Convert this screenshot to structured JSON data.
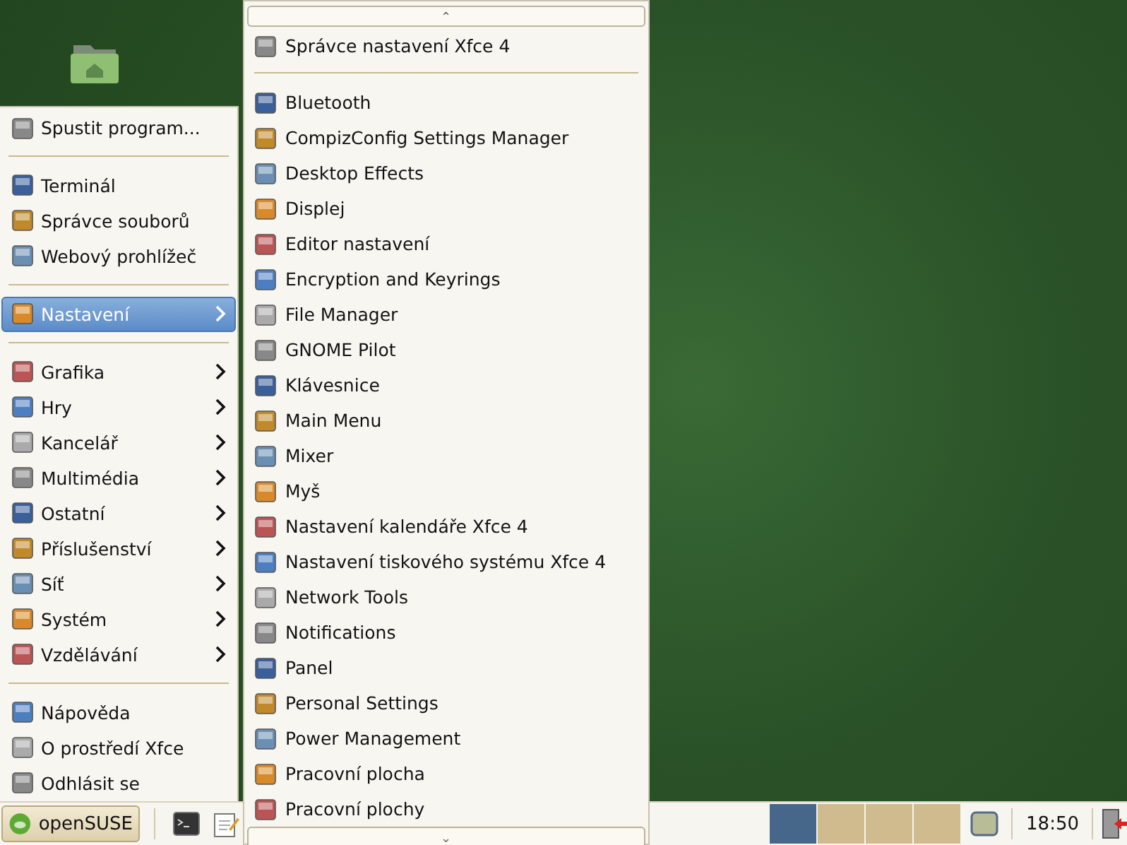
{
  "menu": {
    "sections": [
      {
        "items": [
          {
            "label": "Spustit program...",
            "kind": "item",
            "selected": false
          }
        ]
      },
      {
        "items": [
          {
            "label": "Terminál",
            "kind": "item",
            "selected": false
          },
          {
            "label": "Správce souborů",
            "kind": "item",
            "selected": false
          },
          {
            "label": "Webový prohlížeč",
            "kind": "item",
            "selected": false
          }
        ]
      },
      {
        "items": [
          {
            "label": "Nastavení",
            "kind": "submenu",
            "selected": true
          }
        ]
      },
      {
        "items": [
          {
            "label": "Grafika",
            "kind": "submenu",
            "selected": false
          },
          {
            "label": "Hry",
            "kind": "submenu",
            "selected": false
          },
          {
            "label": "Kancelář",
            "kind": "submenu",
            "selected": false
          },
          {
            "label": "Multimédia",
            "kind": "submenu",
            "selected": false
          },
          {
            "label": "Ostatní",
            "kind": "submenu",
            "selected": false
          },
          {
            "label": "Příslušenství",
            "kind": "submenu",
            "selected": false
          },
          {
            "label": "Síť",
            "kind": "submenu",
            "selected": false
          },
          {
            "label": "Systém",
            "kind": "submenu",
            "selected": false
          },
          {
            "label": "Vzdělávání",
            "kind": "submenu",
            "selected": false
          }
        ]
      },
      {
        "items": [
          {
            "label": "Nápověda",
            "kind": "item",
            "selected": false
          },
          {
            "label": "O prostředí Xfce",
            "kind": "item",
            "selected": false
          },
          {
            "label": "Odhlásit se",
            "kind": "item",
            "selected": false
          }
        ]
      }
    ]
  },
  "submenu": {
    "scroll_up": "⌃",
    "scroll_down": "⌄",
    "sections": [
      {
        "items": [
          "Správce nastavení Xfce 4"
        ]
      },
      {
        "items": [
          "Bluetooth",
          "CompizConfig Settings Manager",
          "Desktop Effects",
          "Displej",
          "Editor nastavení",
          "Encryption and Keyrings",
          "File Manager",
          "GNOME Pilot",
          "Klávesnice",
          "Main Menu",
          "Mixer",
          "Myš",
          "Nastavení kalendáře Xfce 4",
          "Nastavení tiskového systému Xfce 4",
          "Network Tools",
          "Notifications",
          "Panel",
          "Personal Settings",
          "Power Management",
          "Pracovní plocha",
          "Pracovní plochy"
        ]
      }
    ]
  },
  "taskbar": {
    "start_label": "openSUSE",
    "workspaces": [
      {
        "selected": true
      },
      {
        "selected": false
      },
      {
        "selected": false
      },
      {
        "selected": false
      }
    ],
    "clock": "18:50"
  }
}
